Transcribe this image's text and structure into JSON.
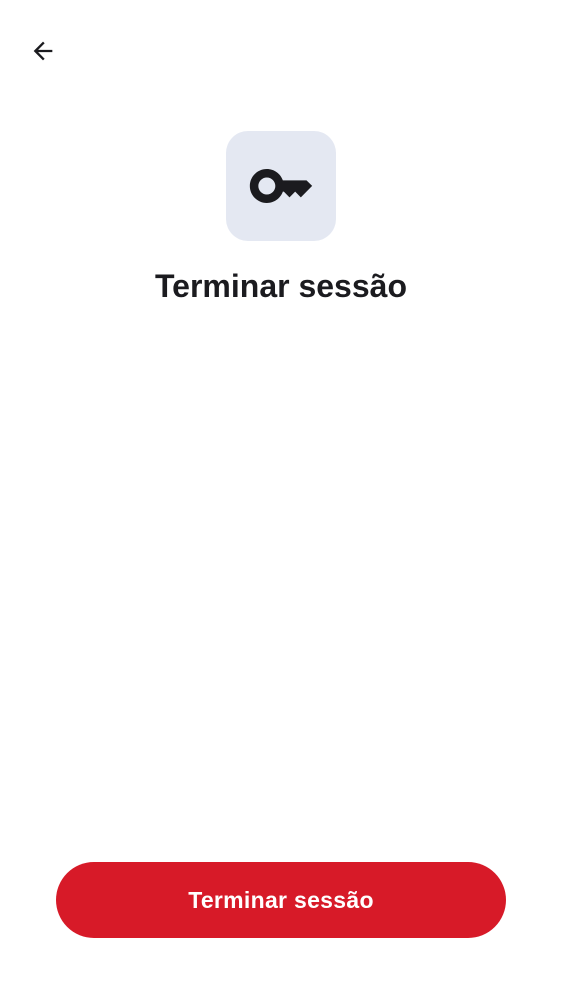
{
  "header": {
    "back_icon": "arrow-back-icon"
  },
  "hero": {
    "icon": "key-icon",
    "tile_color": "#e4e8f2",
    "title": "Terminar sessão"
  },
  "footer": {
    "primary_button_label": "Terminar sessão",
    "primary_button_color": "#d71a28"
  }
}
